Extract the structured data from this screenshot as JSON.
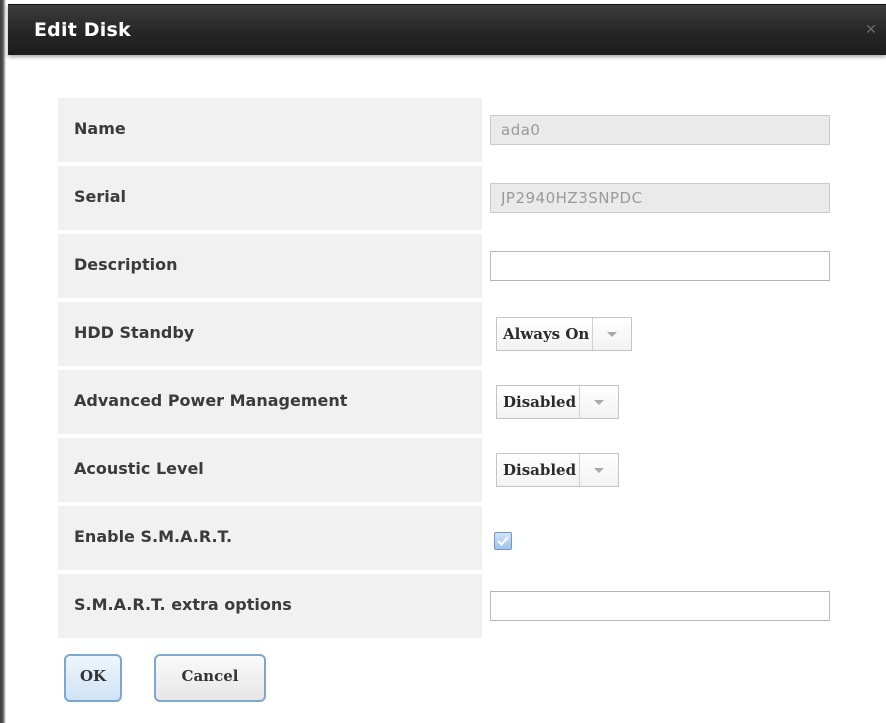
{
  "dialog": {
    "title": "Edit Disk",
    "close_icon": "close-icon"
  },
  "fields": {
    "name": {
      "label": "Name",
      "value": "ada0"
    },
    "serial": {
      "label": "Serial",
      "value": "JP2940HZ3SNPDC"
    },
    "description": {
      "label": "Description",
      "value": ""
    },
    "hdd_standby": {
      "label": "HDD Standby",
      "value": "Always On"
    },
    "apm": {
      "label": "Advanced Power Management",
      "value": "Disabled"
    },
    "acoustic": {
      "label": "Acoustic Level",
      "value": "Disabled"
    },
    "smart": {
      "label": "Enable S.M.A.R.T.",
      "checked": true
    },
    "smart_options": {
      "label": "S.M.A.R.T. extra options",
      "value": ""
    }
  },
  "buttons": {
    "ok": "OK",
    "cancel": "Cancel"
  },
  "colors": {
    "titlebar": "#262626",
    "label_bg": "#f1f1f1",
    "button_border": "#7fa6cf"
  }
}
